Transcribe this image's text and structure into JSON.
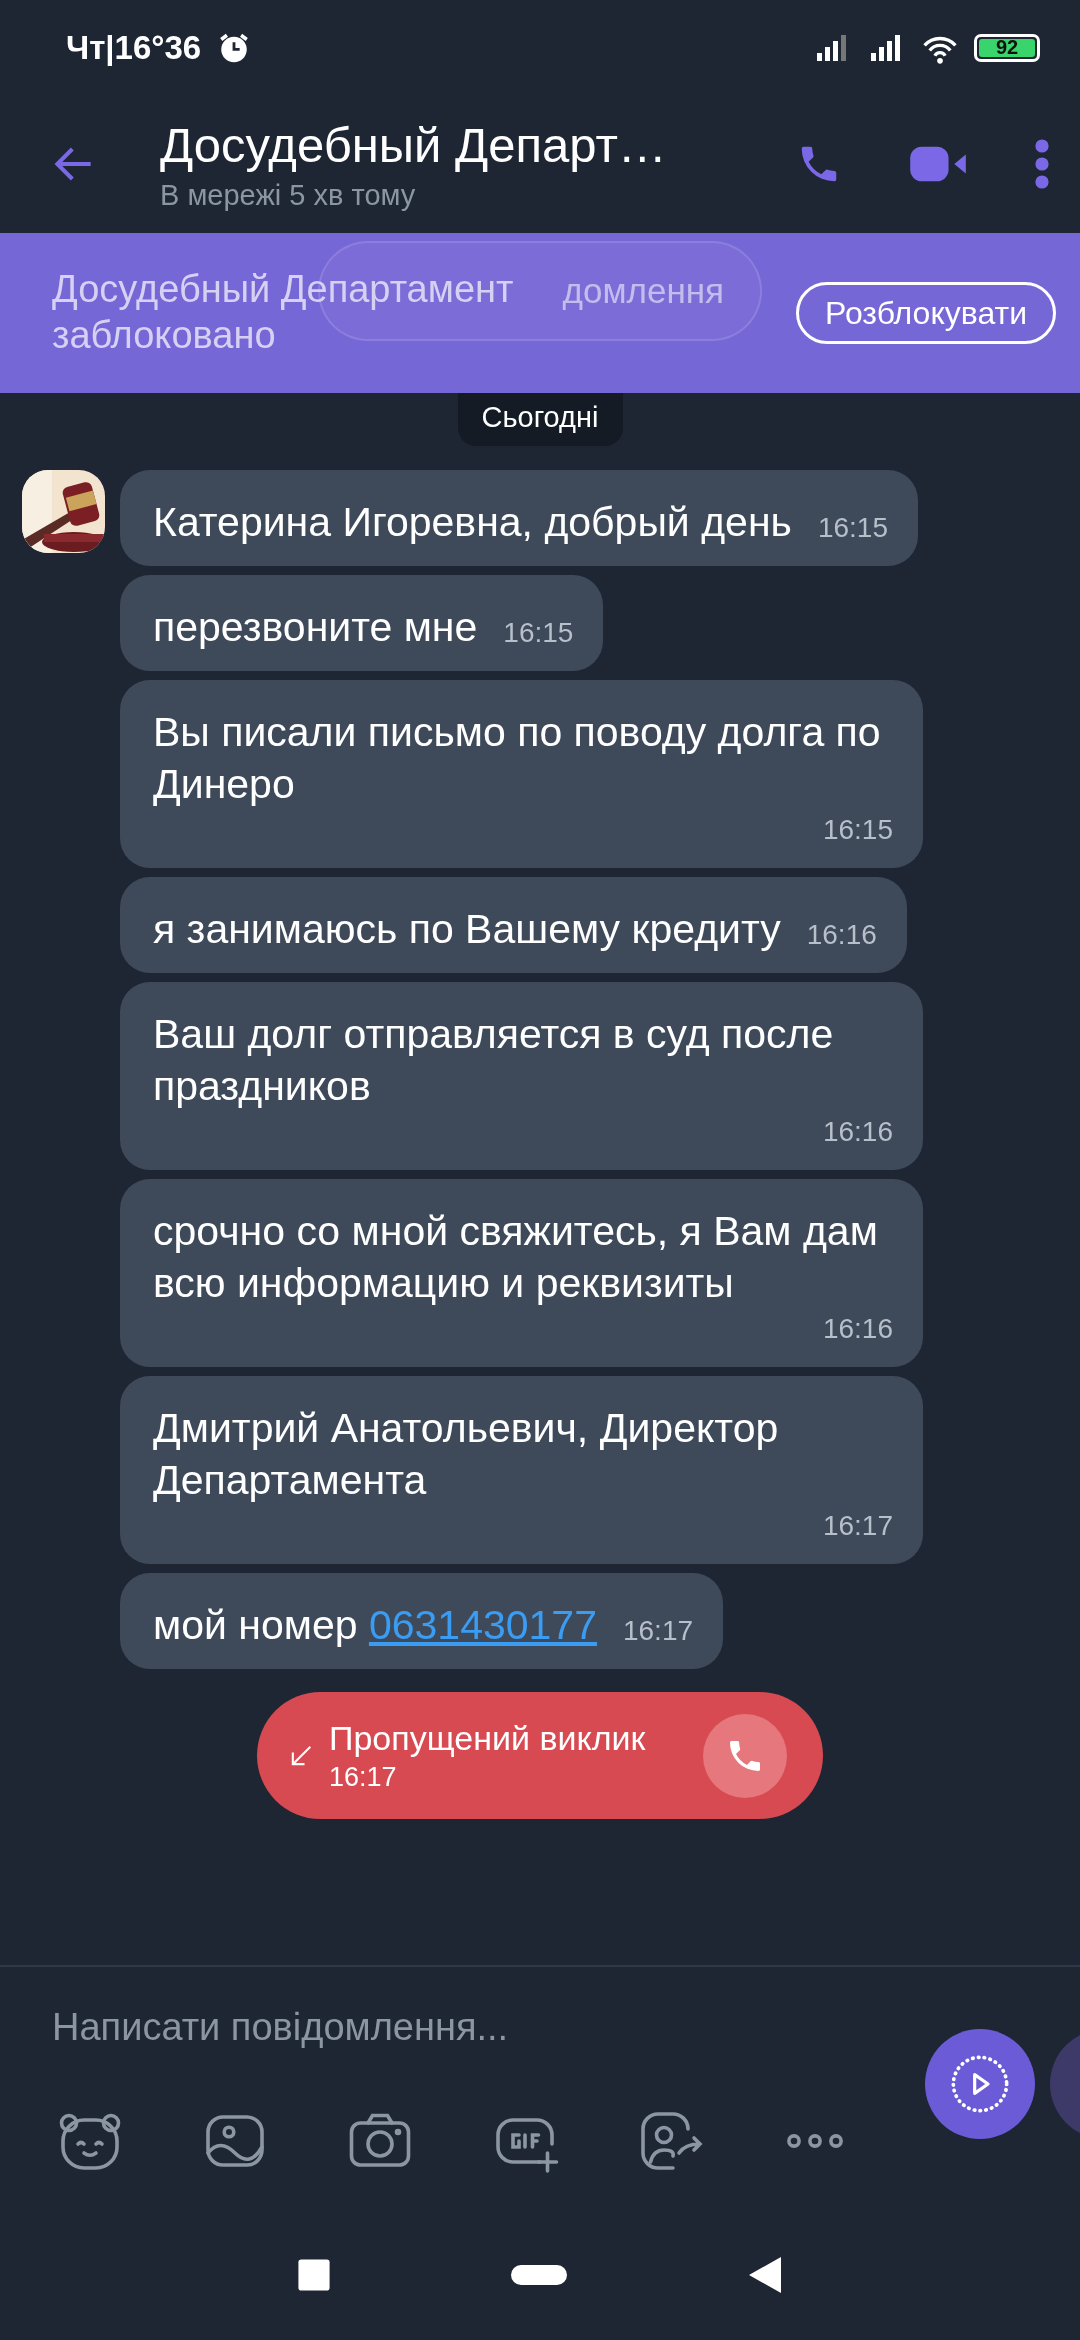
{
  "status_bar": {
    "time": "Чт|16°36",
    "battery": "92"
  },
  "header": {
    "title": "Досудебный Департ…",
    "subtitle": "В мережі 5 хв тому"
  },
  "block_banner": {
    "text": "Досудебный Департамент заблоковано",
    "button": "Розблокувати",
    "ghost_text": "домлення"
  },
  "date_label": "Сьогодні",
  "messages": [
    {
      "kind": "text",
      "text": "Катерина Игоревна, добрый день",
      "time": "16:15"
    },
    {
      "kind": "text",
      "text": "перезвоните мне",
      "time": "16:15"
    },
    {
      "kind": "text",
      "text": "Вы писали письмо по поводу долга по Динеро",
      "time": "16:15"
    },
    {
      "kind": "text",
      "text": "я занимаюсь по Вашему кредиту",
      "time": "16:16"
    },
    {
      "kind": "text",
      "text": "Ваш долг отправляется в суд после праздников",
      "time": "16:16"
    },
    {
      "kind": "text",
      "text": "срочно со мной свяжитесь, я Вам дам всю информацию и реквизиты",
      "time": "16:16"
    },
    {
      "kind": "text",
      "text": "Дмитрий Анатольевич, Директор Департамента",
      "time": "16:17"
    },
    {
      "kind": "link",
      "text": "мой номер",
      "link": "0631430177",
      "time": "16:17"
    }
  ],
  "missed_call": {
    "label": "Пропущений виклик",
    "time": "16:17"
  },
  "composer": {
    "placeholder": "Написати повідомлення..."
  }
}
